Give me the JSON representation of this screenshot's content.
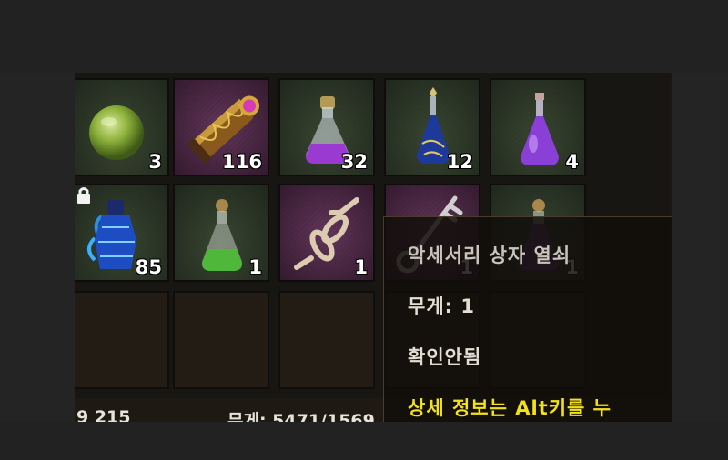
{
  "inventory": {
    "slots": [
      {
        "icon": "green-orb-icon",
        "count": "3"
      },
      {
        "icon": "ornate-scroll-tube-icon",
        "count": "116"
      },
      {
        "icon": "purple-potion-flask-icon",
        "count": "32"
      },
      {
        "icon": "blue-potion-flask-icon",
        "count": "12"
      },
      {
        "icon": "violet-potion-flask-icon",
        "count": "4"
      },
      {
        "icon": "blue-ornate-jar-icon",
        "count": "85",
        "locked": true
      },
      {
        "icon": "green-potion-flask-icon",
        "count": "1"
      },
      {
        "icon": "chain-links-icon",
        "count": "1"
      },
      {
        "icon": "accessory-box-key-icon",
        "count": "1"
      },
      {
        "icon": "dark-potion-flask-icon",
        "count": "1"
      }
    ],
    "status": {
      "gold_fragment": "9 215",
      "weight_fragment": "무게: 5471/1569"
    }
  },
  "tooltip": {
    "item_name": "악세서리 상자 열쇠",
    "weight": "무게: 1",
    "identified": "확인안됨",
    "hint": "상세 정보는 Alt키를 누"
  },
  "colors": {
    "tooltip_hint": "#f3e21a",
    "slot_border": "#0e0d0b"
  }
}
